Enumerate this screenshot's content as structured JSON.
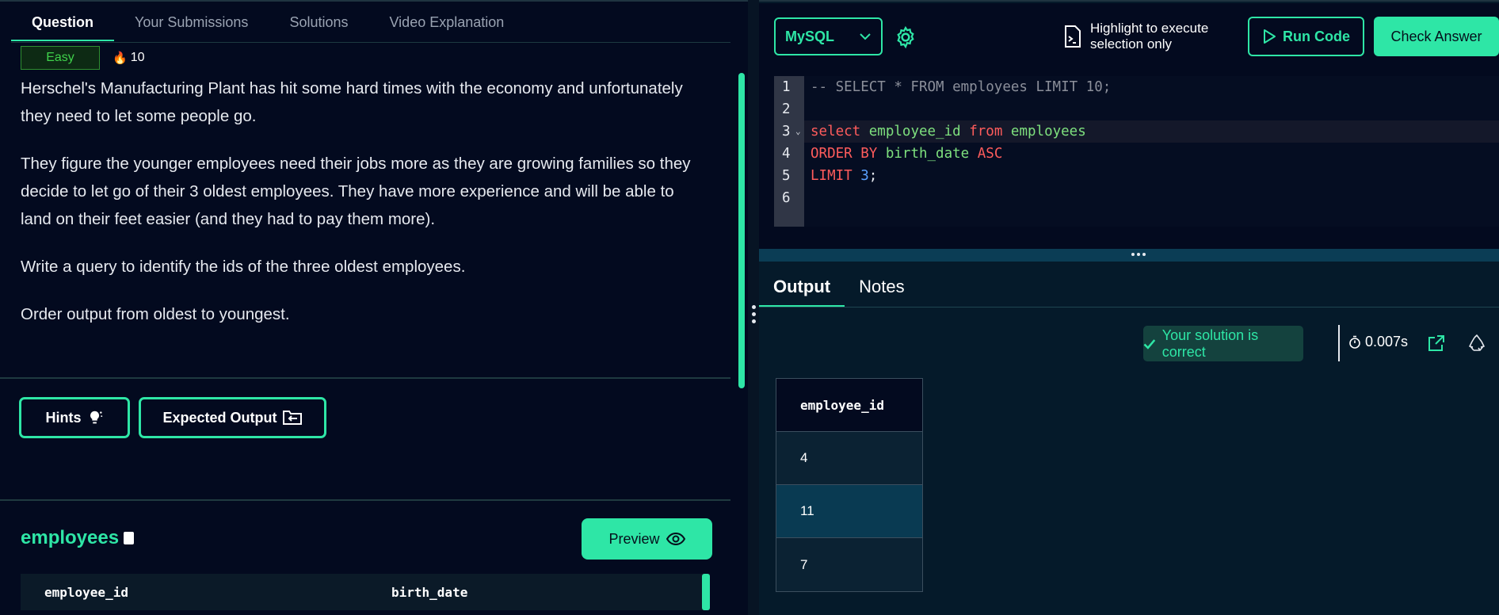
{
  "question_tabs": [
    "Question",
    "Your Submissions",
    "Solutions",
    "Video Explanation"
  ],
  "difficulty": "Easy",
  "xp": "10",
  "description": [
    "Herschel's Manufacturing Plant has hit some hard times with the economy and unfortunately they need to let some people go.",
    "They figure the younger employees need their jobs more as they are growing families so they decide to let go of their 3 oldest employees. They have more experience and will be able to land on their feet easier (and they had to pay them more).",
    "Write a query to identify the ids of the three oldest employees.",
    "Order output from oldest to youngest."
  ],
  "buttons": {
    "hints": "Hints",
    "expected_output": "Expected Output",
    "preview": "Preview"
  },
  "table": {
    "name": "employees",
    "columns": [
      "employee_id",
      "birth_date"
    ]
  },
  "toolbar": {
    "language": "MySQL",
    "highlight_line1": "Highlight to execute",
    "highlight_line2": "selection only",
    "run": "Run Code",
    "check": "Check Answer"
  },
  "code_lines": [
    "-- SELECT * FROM employees LIMIT 10;",
    "",
    "select employee_id from employees",
    "ORDER BY birth_date ASC",
    "LIMIT 3;",
    ""
  ],
  "output_tabs": [
    "Output",
    "Notes"
  ],
  "result": {
    "message": "Your solution is correct",
    "time": "0.007s"
  },
  "result_table": {
    "header": "employee_id",
    "rows": [
      "4",
      "11",
      "7"
    ]
  },
  "colors": {
    "accent": "#2ee6a6",
    "background": "#030a1f",
    "success_bg": "#14423e"
  }
}
